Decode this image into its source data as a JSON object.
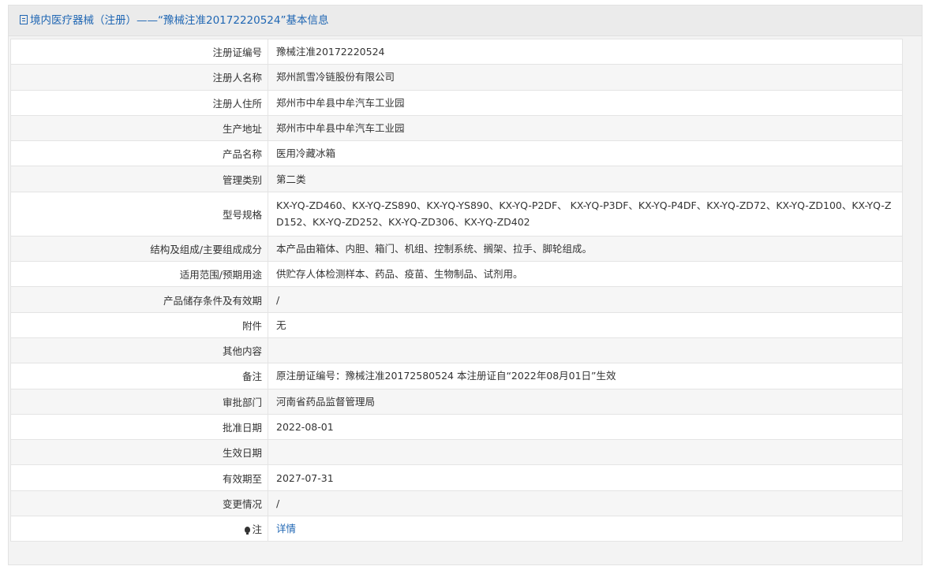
{
  "header": {
    "title": "境内医疗器械（注册）——“豫械注准20172220524”基本信息"
  },
  "rows": [
    {
      "label": "注册证编号",
      "value": "豫械注准20172220524"
    },
    {
      "label": "注册人名称",
      "value": "郑州凯雪冷链股份有限公司"
    },
    {
      "label": "注册人住所",
      "value": "郑州市中牟县中牟汽车工业园"
    },
    {
      "label": "生产地址",
      "value": "郑州市中牟县中牟汽车工业园"
    },
    {
      "label": "产品名称",
      "value": "医用冷藏冰箱"
    },
    {
      "label": "管理类别",
      "value": "第二类"
    },
    {
      "label": "型号规格",
      "value": "KX-YQ-ZD460、KX-YQ-ZS890、KX-YQ-YS890、KX-YQ-P2DF、 KX-YQ-P3DF、KX-YQ-P4DF、KX-YQ-ZD72、KX-YQ-ZD100、KX-YQ-ZD152、KX-YQ-ZD252、KX-YQ-ZD306、KX-YQ-ZD402"
    },
    {
      "label": "结构及组成/主要组成成分",
      "value": "本产品由箱体、内胆、箱门、机组、控制系统、搁架、拉手、脚轮组成。"
    },
    {
      "label": "适用范围/预期用途",
      "value": "供贮存人体检测样本、药品、疫苗、生物制品、试剂用。"
    },
    {
      "label": "产品储存条件及有效期",
      "value": "/"
    },
    {
      "label": "附件",
      "value": "无"
    },
    {
      "label": "其他内容",
      "value": ""
    },
    {
      "label": "备注",
      "value": "原注册证编号：豫械注准20172580524 本注册证自“2022年08月01日”生效"
    },
    {
      "label": "审批部门",
      "value": "河南省药品监督管理局"
    },
    {
      "label": "批准日期",
      "value": "2022-08-01"
    },
    {
      "label": "生效日期",
      "value": ""
    },
    {
      "label": "有效期至",
      "value": "2027-07-31"
    },
    {
      "label": "变更情况",
      "value": "/"
    }
  ],
  "note": {
    "label": "注",
    "link_text": "详情",
    "icon": "bulb-icon"
  },
  "colors": {
    "header_text": "#1f66b3",
    "link": "#1f66b3",
    "row_alt": "#f6f6f6",
    "border": "#e4e4e4"
  }
}
